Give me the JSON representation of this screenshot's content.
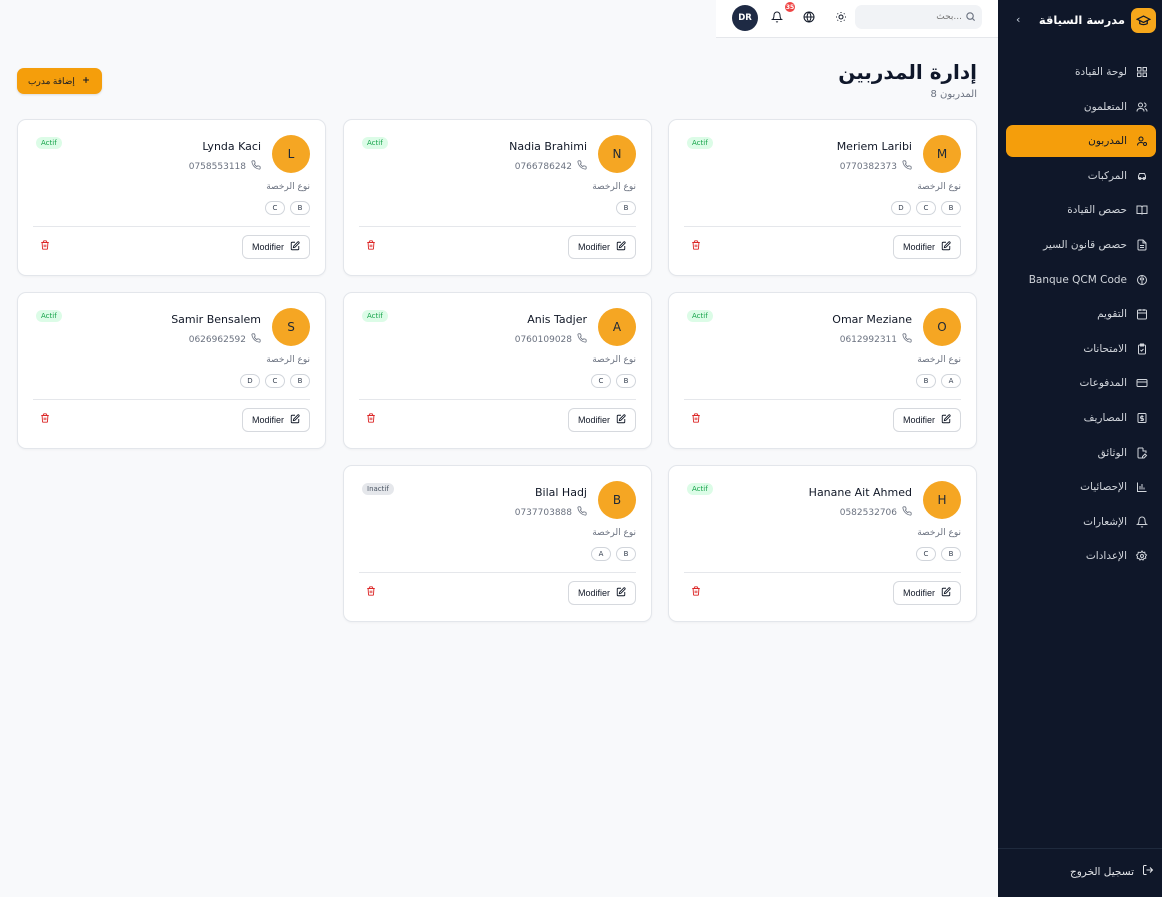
{
  "sidebar": {
    "brand": "مدرسة السياقة",
    "collapse_icon": "chevron-left-icon",
    "items": [
      {
        "label": "لوحة القيادة",
        "icon": "grid-icon",
        "active": false
      },
      {
        "label": "المتعلمون",
        "icon": "users-icon",
        "active": false
      },
      {
        "label": "المدربون",
        "icon": "user-cog-icon",
        "active": true
      },
      {
        "label": "المركبات",
        "icon": "car-icon",
        "active": false
      },
      {
        "label": "حصص القيادة",
        "icon": "book-icon",
        "active": false
      },
      {
        "label": "حصص قانون السير",
        "icon": "file-text-icon",
        "active": false
      },
      {
        "label": "Banque QCM Code",
        "icon": "brain-icon",
        "active": false
      },
      {
        "label": "التقويم",
        "icon": "calendar-icon",
        "active": false
      },
      {
        "label": "الامتحانات",
        "icon": "clipboard-check-icon",
        "active": false
      },
      {
        "label": "المدفوعات",
        "icon": "credit-card-icon",
        "active": false
      },
      {
        "label": "المصاريف",
        "icon": "dollar-icon",
        "active": false
      },
      {
        "label": "الوثائق",
        "icon": "file-edit-icon",
        "active": false
      },
      {
        "label": "الإحصائيات",
        "icon": "bar-chart-icon",
        "active": false
      },
      {
        "label": "الإشعارات",
        "icon": "bell-icon",
        "active": false
      },
      {
        "label": "الإعدادات",
        "icon": "settings-icon",
        "active": false
      }
    ],
    "logout": "تسجيل الخروج"
  },
  "topbar": {
    "search_placeholder": "بحث...",
    "notification_count": "35",
    "user_initials": "DR"
  },
  "header": {
    "title": "إدارة المدربين",
    "subtitle": "8 المدربون",
    "add_button": "إضافة مدرب"
  },
  "card_labels": {
    "license_label": "نوع الرخصة",
    "edit_label": "Modifier"
  },
  "instructors": [
    {
      "initial": "M",
      "name": "Meriem Laribi",
      "phone": "0770382373",
      "status": "Actif",
      "active": true,
      "licenses": [
        "B",
        "C",
        "D"
      ]
    },
    {
      "initial": "N",
      "name": "Nadia Brahimi",
      "phone": "0766786242",
      "status": "Actif",
      "active": true,
      "licenses": [
        "B"
      ]
    },
    {
      "initial": "L",
      "name": "Lynda Kaci",
      "phone": "0758553118",
      "status": "Actif",
      "active": true,
      "licenses": [
        "B",
        "C"
      ]
    },
    {
      "initial": "O",
      "name": "Omar Meziane",
      "phone": "0612992311",
      "status": "Actif",
      "active": true,
      "licenses": [
        "A",
        "B"
      ]
    },
    {
      "initial": "A",
      "name": "Anis Tadjer",
      "phone": "0760109028",
      "status": "Actif",
      "active": true,
      "licenses": [
        "B",
        "C"
      ]
    },
    {
      "initial": "S",
      "name": "Samir Bensalem",
      "phone": "0626962592",
      "status": "Actif",
      "active": true,
      "licenses": [
        "B",
        "C",
        "D"
      ]
    },
    {
      "initial": "H",
      "name": "Hanane Ait Ahmed",
      "phone": "0582532706",
      "status": "Actif",
      "active": true,
      "licenses": [
        "B",
        "C"
      ]
    },
    {
      "initial": "B",
      "name": "Bilal Hadj",
      "phone": "0737703888",
      "status": "Inactif",
      "active": false,
      "licenses": [
        "B",
        "A"
      ]
    }
  ],
  "colors": {
    "accent": "#f59e0b",
    "sidebar_bg": "#0f1729",
    "active_badge": "#16a34a",
    "delete": "#dc2626"
  }
}
